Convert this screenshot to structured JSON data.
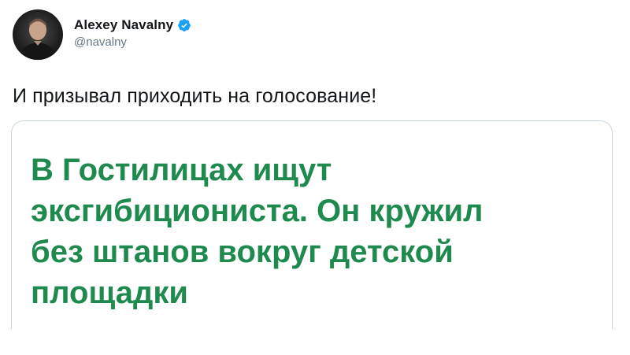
{
  "author": {
    "display_name": "Alexey Navalny",
    "handle": "@navalny",
    "verified": true
  },
  "tweet": {
    "text": "И призывал приходить на голосование!"
  },
  "card": {
    "headline_lines": [
      "В Гостилицах ищут",
      "эксгибициониста. Он кружил",
      "без штанов вокруг детской",
      "площадки"
    ]
  },
  "colors": {
    "headline": "#1e8a4e",
    "verified_badge": "#1da1f2",
    "handle": "#657786",
    "text": "#14171a",
    "card_border": "#ccd6dd"
  },
  "icons": {
    "verified": "verified-badge-icon",
    "avatar": "profile-photo"
  }
}
